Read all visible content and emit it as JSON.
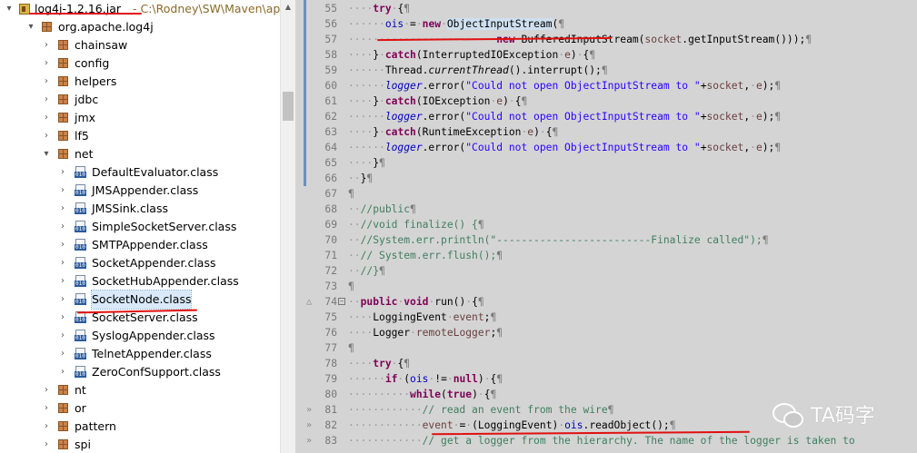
{
  "tree": {
    "jar_name": "log4j-1.2.16.jar",
    "jar_path": "- C:\\Rodney\\SW\\Maven\\apach",
    "root_package": "org.apache.log4j",
    "packages_top": [
      "chainsaw",
      "config",
      "helpers",
      "jdbc",
      "jmx",
      "lf5"
    ],
    "net_package": "net",
    "net_classes": [
      "DefaultEvaluator.class",
      "JMSAppender.class",
      "JMSSink.class",
      "SimpleSocketServer.class",
      "SMTPAppender.class",
      "SocketAppender.class",
      "SocketHubAppender.class",
      "SocketNode.class",
      "SocketServer.class",
      "SyslogAppender.class",
      "TelnetAppender.class",
      "ZeroConfSupport.class"
    ],
    "packages_bottom": [
      "nt",
      "or",
      "pattern",
      "spi"
    ],
    "selected": "SocketNode.class"
  },
  "editor": {
    "line_numbers": [
      "55",
      "56",
      "57",
      "58",
      "59",
      "60",
      "61",
      "62",
      "63",
      "64",
      "65",
      "66",
      "67",
      "68",
      "69",
      "70",
      "71",
      "72",
      "73",
      "74",
      "75",
      "76",
      "77",
      "78",
      "79",
      "80",
      "81",
      "82",
      "83"
    ],
    "markers": {
      "74": "△",
      "81": "»",
      "82": "»",
      "83": "»"
    }
  },
  "watermark": {
    "text": "TA码字"
  },
  "colors": {
    "keyword": "#7f0055",
    "string": "#2a00ff",
    "comment": "#3f7f5f",
    "field": "#0000c0",
    "annotation": "#e01010",
    "editor_bg": "#d4d4d4"
  }
}
